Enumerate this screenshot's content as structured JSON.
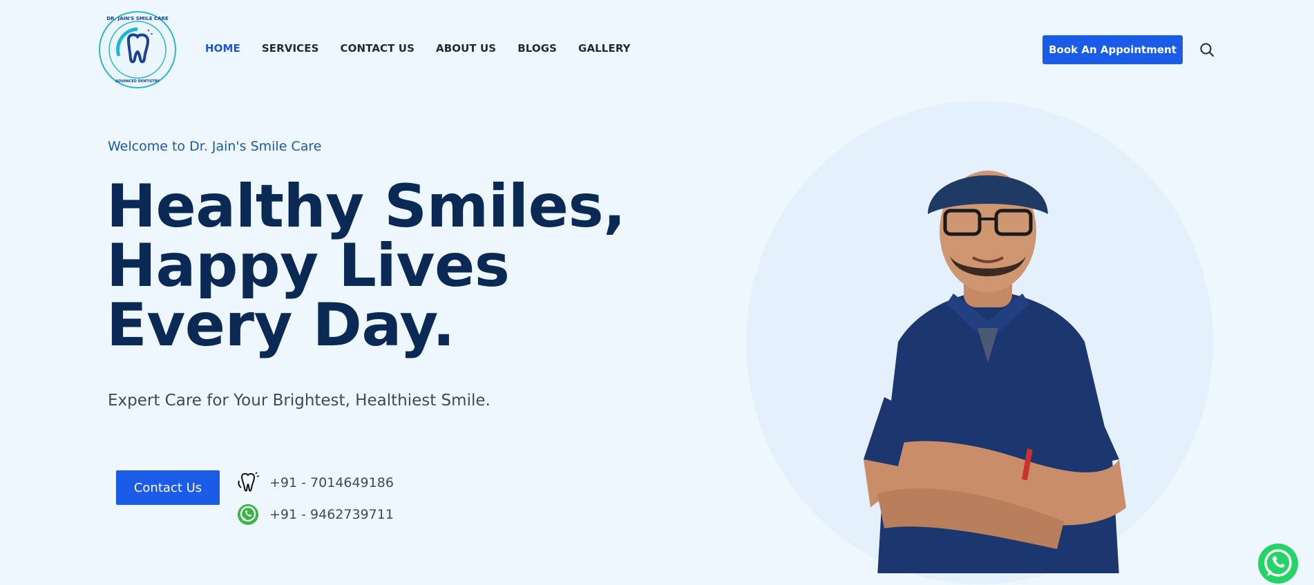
{
  "brand": {
    "logo_text_top": "DR. JAIN'S SMILE CARE",
    "logo_text_bottom": "ADVANCED DENTISTRY",
    "logo_icon": "tooth-icon"
  },
  "nav": {
    "items": [
      {
        "label": "HOME",
        "active": true
      },
      {
        "label": "SERVICES",
        "active": false
      },
      {
        "label": "CONTACT US",
        "active": false
      },
      {
        "label": "ABOUT US",
        "active": false
      },
      {
        "label": "BLOGS",
        "active": false
      },
      {
        "label": "GALLERY",
        "active": false
      }
    ],
    "cta_label": "Book An Appointment",
    "search_icon": "search-icon"
  },
  "hero": {
    "welcome": "Welcome to Dr. Jain's Smile Care",
    "headline": [
      "Healthy Smiles,",
      "Happy Lives",
      "Every Day."
    ],
    "subtitle": "Expert Care for Your Brightest, Healthiest Smile.",
    "contact_button": "Contact Us",
    "phones": [
      {
        "icon": "tooth-phone-icon",
        "number": "+91 - 7014649186"
      },
      {
        "icon": "whatsapp-icon",
        "number": "+91 - 9462739711"
      }
    ]
  },
  "colors": {
    "background": "#eef7fd",
    "accent": "#1a5be8",
    "heading": "#0a2a55",
    "welcome": "#1b5aa8",
    "whatsapp": "#25d366"
  },
  "floating": {
    "whatsapp_icon": "whatsapp-float-icon"
  }
}
